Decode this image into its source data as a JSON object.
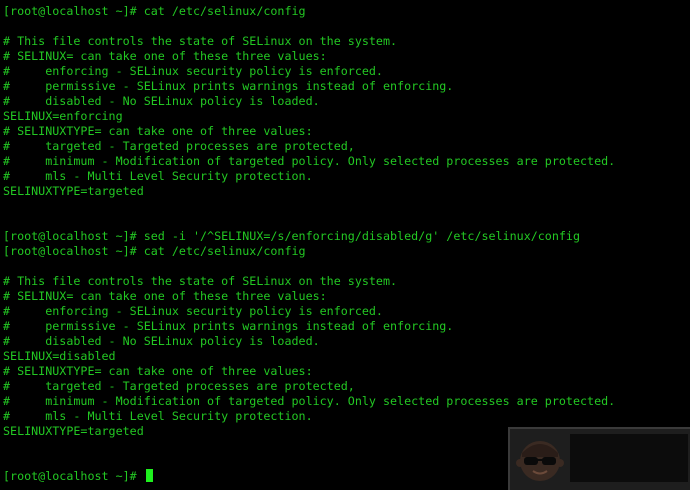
{
  "terminal": {
    "lines": [
      "[root@localhost ~]# cat /etc/selinux/config",
      "",
      "# This file controls the state of SELinux on the system.",
      "# SELINUX= can take one of these three values:",
      "#     enforcing - SELinux security policy is enforced.",
      "#     permissive - SELinux prints warnings instead of enforcing.",
      "#     disabled - No SELinux policy is loaded.",
      "SELINUX=enforcing",
      "# SELINUXTYPE= can take one of three values:",
      "#     targeted - Targeted processes are protected,",
      "#     minimum - Modification of targeted policy. Only selected processes are protected.",
      "#     mls - Multi Level Security protection.",
      "SELINUXTYPE=targeted",
      "",
      "",
      "[root@localhost ~]# sed -i '/^SELINUX=/s/enforcing/disabled/g' /etc/selinux/config",
      "[root@localhost ~]# cat /etc/selinux/config",
      "",
      "# This file controls the state of SELinux on the system.",
      "# SELINUX= can take one of these three values:",
      "#     enforcing - SELinux security policy is enforced.",
      "#     permissive - SELinux prints warnings instead of enforcing.",
      "#     disabled - No SELinux policy is loaded.",
      "SELINUX=disabled",
      "# SELINUXTYPE= can take one of three values:",
      "#     targeted - Targeted processes are protected,",
      "#     minimum - Modification of targeted policy. Only selected processes are protected.",
      "#     mls - Multi Level Security protection.",
      "SELINUXTYPE=targeted",
      "",
      "",
      "[root@localhost ~]# "
    ],
    "text_color": "#23c823",
    "cursor_color": "#1ef01e",
    "background_color": "#000000"
  },
  "watermark": {
    "icon": "sunglasses-face-logo-icon"
  }
}
